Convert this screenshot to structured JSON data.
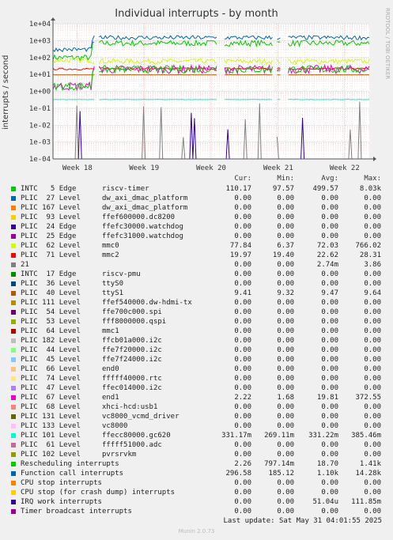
{
  "chart_data": {
    "type": "line",
    "title": "Individual interrupts - by month",
    "ylabel": "interrupts / second",
    "yscale": "log",
    "ylim": [
      0.0001,
      10000
    ],
    "y_tick_labels": [
      "1e+04",
      "1e+03",
      "1e+02",
      "1e+01",
      "1e+00",
      "1e-01",
      "1e-02",
      "1e-03",
      "1e-04"
    ],
    "x_tick_labels": [
      "Week 18",
      "Week 19",
      "Week 20",
      "Week 21",
      "Week 22"
    ],
    "grid": true,
    "legend_position": "bottom",
    "legend_columns": [
      "Cur:",
      "Min:",
      "Avg:",
      "Max:"
    ],
    "series": [
      {
        "name": "INTC   5 Edge      riscv-timer",
        "color": "#00cc00",
        "values": [
          "110.17",
          "97.57",
          "499.57",
          "8.03k"
        ]
      },
      {
        "name": "PLIC  27 Level     dw_axi_dmac_platform",
        "color": "#0066b3",
        "values": [
          "0.00",
          "0.00",
          "0.00",
          "0.00"
        ]
      },
      {
        "name": "PLIC 167 Level     dw_axi_dmac_platform",
        "color": "#ff8000",
        "values": [
          "0.00",
          "0.00",
          "0.00",
          "0.00"
        ]
      },
      {
        "name": "PLIC  93 Level     ffef600000.dc8200",
        "color": "#ffcc00",
        "values": [
          "0.00",
          "0.00",
          "0.00",
          "0.00"
        ]
      },
      {
        "name": "PLIC  24 Edge      ffefc30000.watchdog",
        "color": "#330099",
        "values": [
          "0.00",
          "0.00",
          "0.00",
          "0.00"
        ]
      },
      {
        "name": "PLIC  25 Edge      ffefc31000.watchdog",
        "color": "#990099",
        "values": [
          "0.00",
          "0.00",
          "0.00",
          "0.00"
        ]
      },
      {
        "name": "PLIC  62 Level     mmc0",
        "color": "#ccff00",
        "values": [
          "77.84",
          "6.37",
          "72.03",
          "766.02"
        ]
      },
      {
        "name": "PLIC  71 Level     mmc2",
        "color": "#ff0000",
        "values": [
          "19.97",
          "19.40",
          "22.62",
          "28.31"
        ]
      },
      {
        "name": "21",
        "color": "#808080",
        "values": [
          "0.00",
          "0.00",
          "2.74m",
          "3.86"
        ]
      },
      {
        "name": "INTC  17 Edge      riscv-pmu",
        "color": "#008f00",
        "values": [
          "0.00",
          "0.00",
          "0.00",
          "0.00"
        ]
      },
      {
        "name": "PLIC  36 Level     ttyS0",
        "color": "#00487d",
        "values": [
          "0.00",
          "0.00",
          "0.00",
          "0.00"
        ]
      },
      {
        "name": "PLIC  40 Level     ttyS1",
        "color": "#b35a00",
        "values": [
          "9.41",
          "9.32",
          "9.47",
          "9.64"
        ]
      },
      {
        "name": "PLIC 111 Level     ffef540000.dw-hdmi-tx",
        "color": "#b38f00",
        "values": [
          "0.00",
          "0.00",
          "0.00",
          "0.00"
        ]
      },
      {
        "name": "PLIC  54 Level     ffe700c000.spi",
        "color": "#6b006b",
        "values": [
          "0.00",
          "0.00",
          "0.00",
          "0.00"
        ]
      },
      {
        "name": "PLIC  53 Level     fff8000000.qspi",
        "color": "#8fb300",
        "values": [
          "0.00",
          "0.00",
          "0.00",
          "0.00"
        ]
      },
      {
        "name": "PLIC  64 Level     mmc1",
        "color": "#b30000",
        "values": [
          "0.00",
          "0.00",
          "0.00",
          "0.00"
        ]
      },
      {
        "name": "PLIC 182 Level     ffcb01a000.i2c",
        "color": "#bebebe",
        "values": [
          "0.00",
          "0.00",
          "0.00",
          "0.00"
        ]
      },
      {
        "name": "PLIC  44 Level     ffe7f20000.i2c",
        "color": "#80ff80",
        "values": [
          "0.00",
          "0.00",
          "0.00",
          "0.00"
        ]
      },
      {
        "name": "PLIC  45 Level     ffe7f24000.i2c",
        "color": "#80c9ff",
        "values": [
          "0.00",
          "0.00",
          "0.00",
          "0.00"
        ]
      },
      {
        "name": "PLIC  66 Level     end0",
        "color": "#ffc080",
        "values": [
          "0.00",
          "0.00",
          "0.00",
          "0.00"
        ]
      },
      {
        "name": "PLIC  74 Level     fffff40000.rtc",
        "color": "#ffe680",
        "values": [
          "0.00",
          "0.00",
          "0.00",
          "0.00"
        ]
      },
      {
        "name": "PLIC  47 Level     ffec014000.i2c",
        "color": "#aa80ff",
        "values": [
          "0.00",
          "0.00",
          "0.00",
          "0.00"
        ]
      },
      {
        "name": "PLIC  67 Level     end1",
        "color": "#ee00cc",
        "values": [
          "2.22",
          "1.68",
          "19.81",
          "372.55"
        ]
      },
      {
        "name": "PLIC  68 Level     xhci-hcd:usb1",
        "color": "#ff8080",
        "values": [
          "0.00",
          "0.00",
          "0.00",
          "0.00"
        ]
      },
      {
        "name": "PLIC 131 Level     vc8000_vcmd_driver",
        "color": "#666600",
        "values": [
          "0.00",
          "0.00",
          "0.00",
          "0.00"
        ]
      },
      {
        "name": "PLIC 133 Level     vc8000",
        "color": "#ffbfff",
        "values": [
          "0.00",
          "0.00",
          "0.00",
          "0.00"
        ]
      },
      {
        "name": "PLIC 101 Level     ffecc80000.gc620",
        "color": "#00ffcc",
        "values": [
          "331.17m",
          "269.11m",
          "331.22m",
          "385.46m"
        ]
      },
      {
        "name": "PLIC  61 Level     fffff51000.adc",
        "color": "#cc6699",
        "values": [
          "0.00",
          "0.00",
          "0.00",
          "0.00"
        ]
      },
      {
        "name": "PLIC 102 Level     pvrsrvkm",
        "color": "#999900",
        "values": [
          "0.00",
          "0.00",
          "0.00",
          "0.00"
        ]
      },
      {
        "name": "Rescheduling interrupts",
        "color": "#00cc00",
        "values": [
          "2.26",
          "797.14m",
          "18.70",
          "1.41k"
        ]
      },
      {
        "name": "Function call interrupts",
        "color": "#0066b3",
        "values": [
          "296.58",
          "185.12",
          "1.10k",
          "14.28k"
        ]
      },
      {
        "name": "CPU stop interrupts",
        "color": "#ff8000",
        "values": [
          "0.00",
          "0.00",
          "0.00",
          "0.00"
        ]
      },
      {
        "name": "CPU stop (for crash dump) interrupts",
        "color": "#ffcc00",
        "values": [
          "0.00",
          "0.00",
          "0.00",
          "0.00"
        ]
      },
      {
        "name": "IRQ work interrupts",
        "color": "#330099",
        "values": [
          "0.00",
          "0.00",
          "51.04u",
          "111.85m"
        ]
      },
      {
        "name": "Timer broadcast interrupts",
        "color": "#990099",
        "values": [
          "0.00",
          "0.00",
          "0.00",
          "0.00"
        ]
      }
    ]
  },
  "side_label": "RRDTOOL / TOBI OETIKER",
  "last_update": "Last update: Sat May 31 04:01:55 2025",
  "footer": "Munin 2.0.73"
}
